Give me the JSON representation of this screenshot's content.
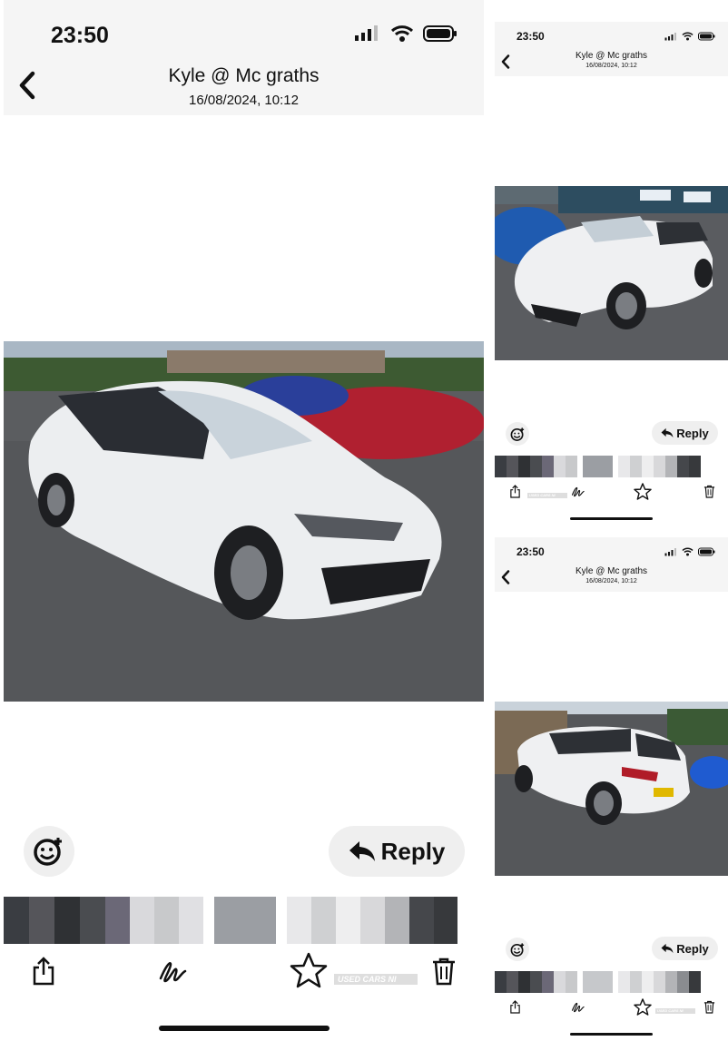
{
  "status": {
    "time": "23:50"
  },
  "header": {
    "title": "Kyle @ Mc graths",
    "subtitle": "16/08/2024, 10:12"
  },
  "actions": {
    "reply_label": "Reply"
  },
  "watermark": {
    "text": "USED CARS NI"
  },
  "icons": {
    "back": "chevron-left-icon",
    "signal": "cellular-signal-icon",
    "wifi": "wifi-icon",
    "battery": "battery-icon",
    "emoji": "add-reaction-icon",
    "reply": "reply-arrow-icon",
    "share": "share-icon",
    "markup": "markup-icon",
    "star": "star-icon",
    "trash": "trash-icon"
  },
  "colors": {
    "accent_header_bg": "#f5f5f5",
    "pill_bg": "#efefef"
  }
}
